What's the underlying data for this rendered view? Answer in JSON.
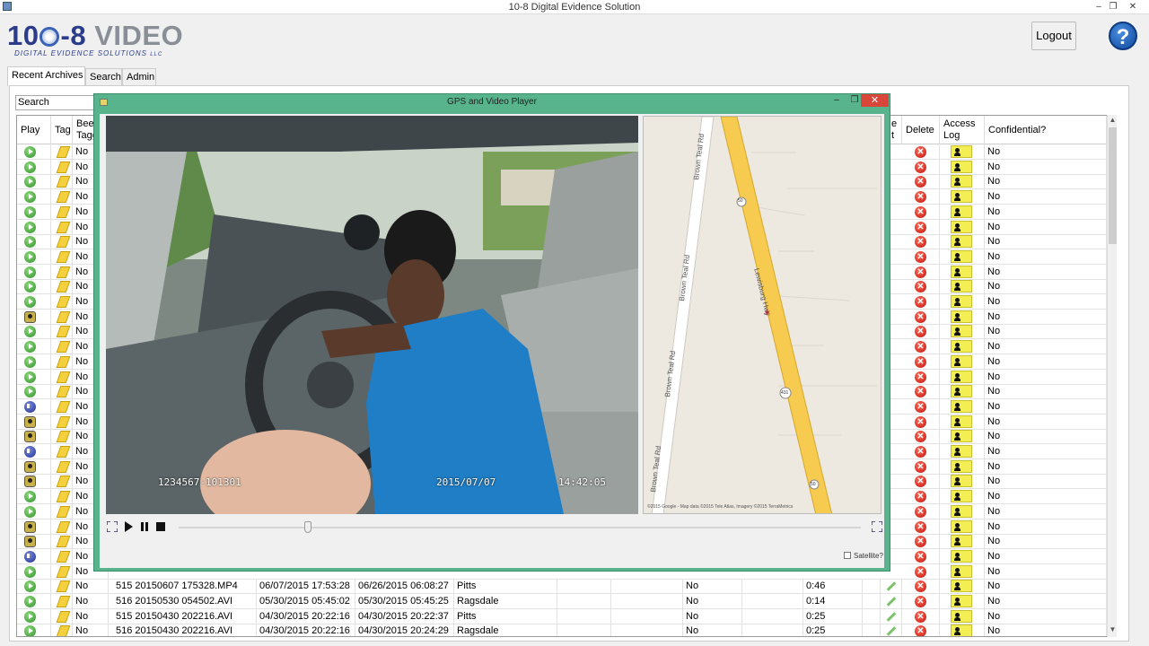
{
  "app": {
    "title": "10-8 Digital Evidence Solution",
    "window_buttons": [
      "–",
      "❐",
      "✕"
    ],
    "logo": {
      "part1": "10",
      "part2": "8",
      "part3": "VIDEO",
      "tagline": "DIGITAL EVIDENCE SOLUTIONS",
      "llc": "LLC"
    },
    "logout_label": "Logout",
    "help_label": "?"
  },
  "tabs": [
    "Recent Archives",
    "Search",
    "Admin"
  ],
  "search": {
    "placeholder": "Search"
  },
  "table": {
    "headers": {
      "play": "Play",
      "tag": "Tag",
      "been_tagged": "Been Tagged",
      "edit": "e t",
      "delete": "Delete",
      "access_log": "Access Log",
      "confidential": "Confidential?"
    },
    "row_icons": [
      "play",
      "play",
      "play",
      "play",
      "play",
      "play",
      "play",
      "play",
      "play",
      "play",
      "play",
      "camera",
      "play",
      "play",
      "play",
      "play",
      "play",
      "audio",
      "camera",
      "camera",
      "audio",
      "camera",
      "camera",
      "play",
      "play",
      "camera",
      "camera",
      "audio",
      "play",
      "play",
      "play",
      "play",
      "play"
    ],
    "row_been_tagged": [
      "No",
      "No",
      "No",
      "No",
      "No",
      "No",
      "No",
      "No",
      "No",
      "No",
      "No",
      "No",
      "No",
      "No",
      "No",
      "No",
      "No",
      "No",
      "No",
      "No",
      "No",
      "No",
      "No",
      "No",
      "No",
      "No",
      "No",
      "No",
      "No",
      "No",
      "No",
      "No",
      "No"
    ],
    "row_confidential": [
      "No",
      "No",
      "No",
      "No",
      "No",
      "No",
      "No",
      "No",
      "No",
      "No",
      "No",
      "No",
      "No",
      "No",
      "No",
      "No",
      "No",
      "No",
      "No",
      "No",
      "No",
      "No",
      "No",
      "No",
      "No",
      "No",
      "No",
      "No",
      "No",
      "No",
      "No",
      "No",
      "No"
    ],
    "visible_detail_rows": [
      {
        "file": "515 20150607 175328.MP4",
        "created": "06/07/2015 17:53:28",
        "uploaded": "06/26/2015 06:08:27",
        "officer": "Pitts",
        "flag": "No",
        "duration": "0:46"
      },
      {
        "file": "516 20150530 054502.AVI",
        "created": "05/30/2015 05:45:02",
        "uploaded": "05/30/2015 05:45:25",
        "officer": "Ragsdale",
        "flag": "No",
        "duration": "0:14"
      },
      {
        "file": "515 20150430 202216.AVI",
        "created": "04/30/2015 20:22:16",
        "uploaded": "04/30/2015 20:22:37",
        "officer": "Pitts",
        "flag": "No",
        "duration": "0:25"
      },
      {
        "file": "516 20150430 202216.AVI",
        "created": "04/30/2015 20:22:16",
        "uploaded": "04/30/2015 20:24:29",
        "officer": "Ragsdale",
        "flag": "No",
        "duration": "0:25"
      }
    ]
  },
  "player": {
    "title": "GPS and Video Player",
    "osd": {
      "unit": "1234567-101301",
      "date": "2015/07/07",
      "time": "14:42:05"
    },
    "map": {
      "roads": [
        "Brown Teal Rd",
        "Brown Teal Rd",
        "Brown Teal Rd",
        "Brown Teal Rd",
        "Lewisburg Hwy"
      ],
      "shields": [
        "50",
        "431",
        "50"
      ],
      "copyright": "©2015 Google - Map data ©2015 Tele Atlas, Imagery ©2015 TerraMetrics"
    },
    "satellite_label": "Satellite?",
    "accent_color": "#58b48c"
  }
}
